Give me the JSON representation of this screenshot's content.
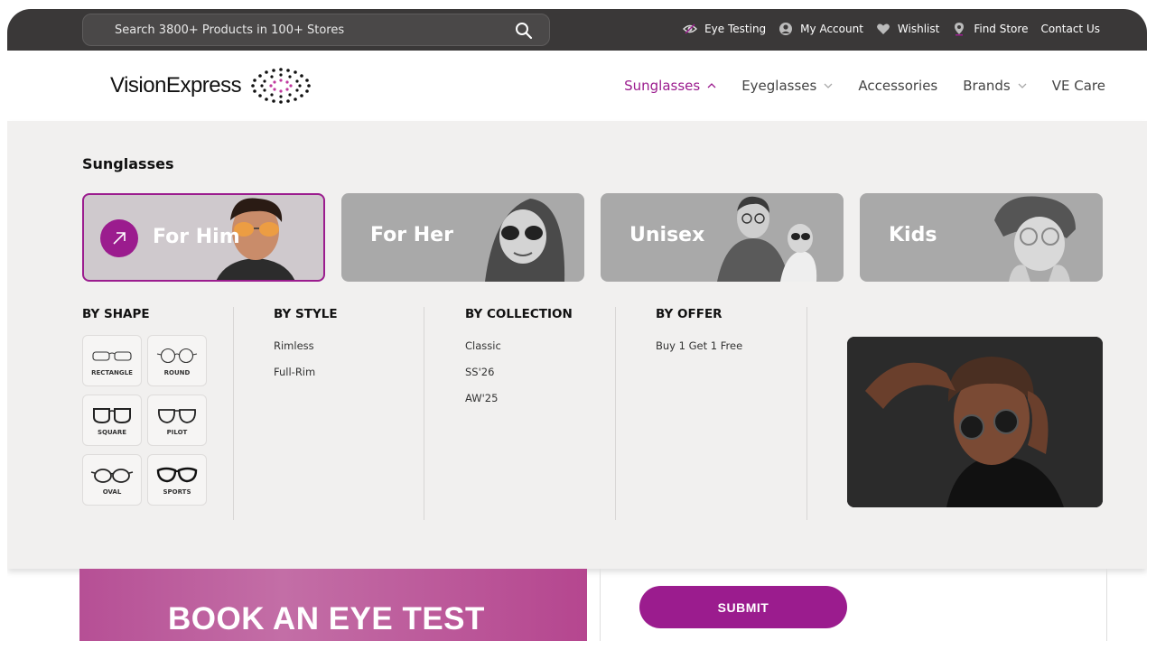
{
  "topbar": {
    "search_placeholder": "Search 3800+ Products in 100+ Stores",
    "links": [
      {
        "label": "Eye Testing",
        "icon": "eye-icon"
      },
      {
        "label": "My Account",
        "icon": "user-icon"
      },
      {
        "label": "Wishlist",
        "icon": "heart-icon"
      },
      {
        "label": "Find Store",
        "icon": "location-pin-icon"
      },
      {
        "label": "Contact Us"
      }
    ]
  },
  "header": {
    "logo_text": "VisionExpress",
    "nav": [
      {
        "label": "Sunglasses",
        "active": true,
        "has_dropdown": true
      },
      {
        "label": "Eyeglasses",
        "has_dropdown": true
      },
      {
        "label": "Accessories"
      },
      {
        "label": "Brands",
        "has_dropdown": true
      },
      {
        "label": "VE Care"
      }
    ]
  },
  "mega_menu": {
    "title": "Sunglasses",
    "cards": [
      {
        "label": "For Him",
        "active": true
      },
      {
        "label": "For Her"
      },
      {
        "label": "Unisex"
      },
      {
        "label": "Kids"
      }
    ],
    "by_shape": {
      "title": "BY SHAPE",
      "shapes": [
        "RECTANGLE",
        "ROUND",
        "SQUARE",
        "PILOT",
        "OVAL",
        "SPORTS"
      ]
    },
    "by_style": {
      "title": "BY STYLE",
      "links": [
        "Rimless",
        "Full-Rim"
      ]
    },
    "by_collection": {
      "title": "BY COLLECTION",
      "links": [
        "Classic",
        "SS'26",
        "AW'25"
      ]
    },
    "by_offer": {
      "title": "BY OFFER",
      "links": [
        "Buy 1 Get 1 Free"
      ]
    }
  },
  "page": {
    "banner_text": "BOOK AN EYE TEST",
    "submit_label": "SUBMIT"
  },
  "colors": {
    "accent": "#9b1c8e",
    "topbar": "#3a3838",
    "menu_bg": "#f1f0ef"
  }
}
